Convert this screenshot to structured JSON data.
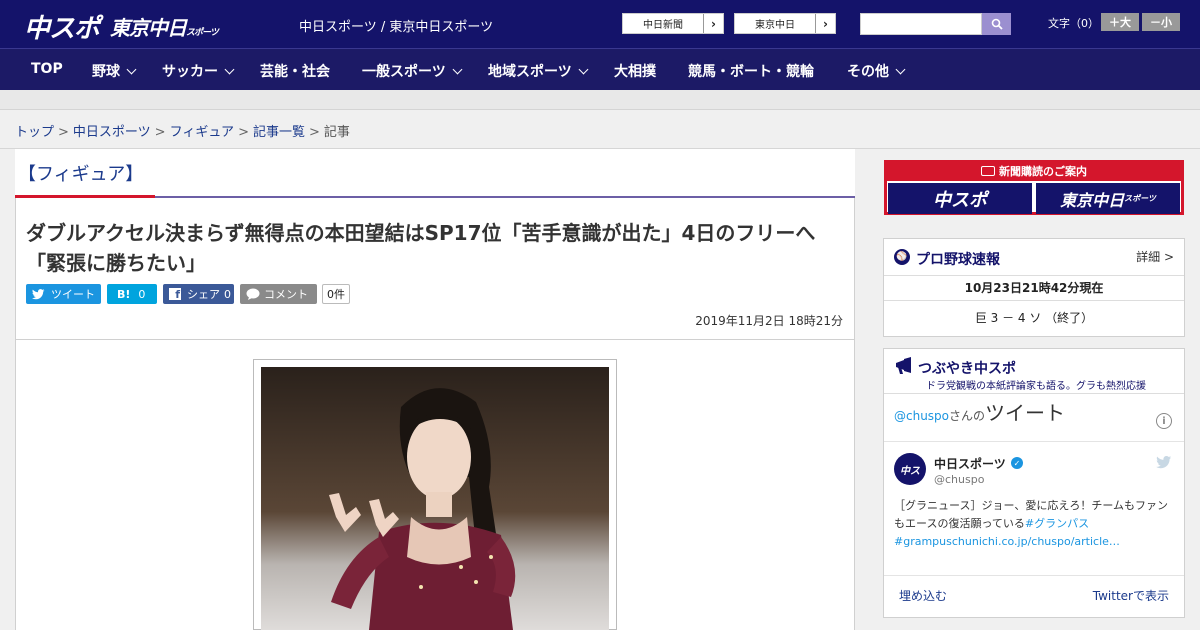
{
  "header": {
    "logo_chuspo": "中スポ",
    "logo_tokyo": "東京中日",
    "logo_tokyo_small": "スポーツ",
    "site_links": "中日スポーツ / 東京中日スポーツ",
    "paper_buttons": [
      "中日新聞",
      "東京中日"
    ],
    "search_placeholder": "",
    "fontsize_label": "文字（0）",
    "fontsize_plus": "＋大",
    "fontsize_minus": "－小"
  },
  "nav": {
    "items": [
      {
        "label": "TOP"
      },
      {
        "label": "野球"
      },
      {
        "label": "サッカー"
      },
      {
        "label": "芸能・社会"
      },
      {
        "label": "一般スポーツ"
      },
      {
        "label": "地域スポーツ"
      },
      {
        "label": "大相撲"
      },
      {
        "label": "競馬・ボート・競輪"
      },
      {
        "label": "その他"
      }
    ]
  },
  "breadcrumb": {
    "items": [
      "トップ",
      "中日スポーツ",
      "フィギュア",
      "記事一覧"
    ],
    "current": "記事"
  },
  "article": {
    "category": "【フィギュア】",
    "headline": "ダブルアクセル決まらず無得点の本田望結はSP17位「苦手意識が出た」4日のフリーへ「緊張に勝ちたい」",
    "share": {
      "tweet": "ツイート",
      "hatena": "B!",
      "hatena_count": "0",
      "facebook": "シェア",
      "facebook_count": "0",
      "comment": "コメント",
      "comment_count": "0件"
    },
    "date": "2019年11月2日 18時21分"
  },
  "sidebar": {
    "ad": {
      "header": "新聞購読のご案内",
      "logo1": "中スポ",
      "logo2": "東京中日",
      "logo2_small": "スポーツ"
    },
    "baseball": {
      "title": "プロ野球速報",
      "detail": "詳細 >",
      "timestamp": "10月23日21時42分現在",
      "score": "巨 3 － 4 ソ （終了）"
    },
    "tsubuyaki": {
      "title": "つぶやき中スポ",
      "subtitle": "ドラ党観戦の本紙評論家も語る。グラも熱烈応援",
      "handle_prefix": "@chuspo",
      "handle_mid": "さんの",
      "handle_suffix": "ツイート",
      "account_name": "中日スポーツ",
      "account_id": "@chuspo",
      "tweet_text": "［グラニュース］ジョー、愛に応えろ！チームもファンもエースの復活願っている",
      "tweet_tag": "#グランパス",
      "tweet_link": "#grampuschunichi.co.jp/chuspo/article…",
      "embed": "埋め込む",
      "view_on_twitter": "Twitterで表示"
    }
  },
  "colors": {
    "header_bg": "#14136a",
    "nav_bg": "#1c1a66",
    "accent_red": "#d4162c",
    "link_blue": "#1b3a8c",
    "twitter": "#1b95e0",
    "facebook": "#3b5998",
    "hatena": "#00a4de"
  }
}
